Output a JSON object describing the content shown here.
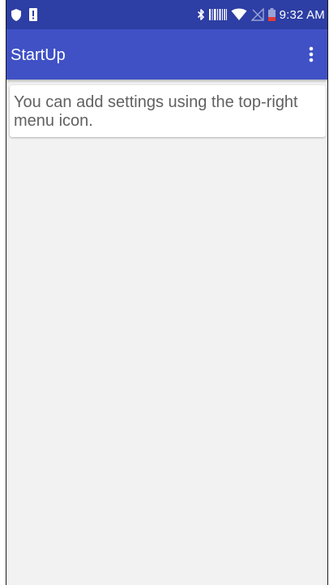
{
  "status_bar": {
    "time": "9:32 AM",
    "icons": [
      "shield-icon",
      "alert-icon",
      "bluetooth-icon",
      "barcode-icon",
      "wifi-icon",
      "no-signal-icon",
      "battery-icon"
    ],
    "battery_color": "#e53935"
  },
  "app_bar": {
    "title": "StartUp",
    "menu_icon": "more-vert-icon",
    "color": "#3f51c5"
  },
  "main": {
    "message": "You can add settings using the top-right menu icon."
  }
}
